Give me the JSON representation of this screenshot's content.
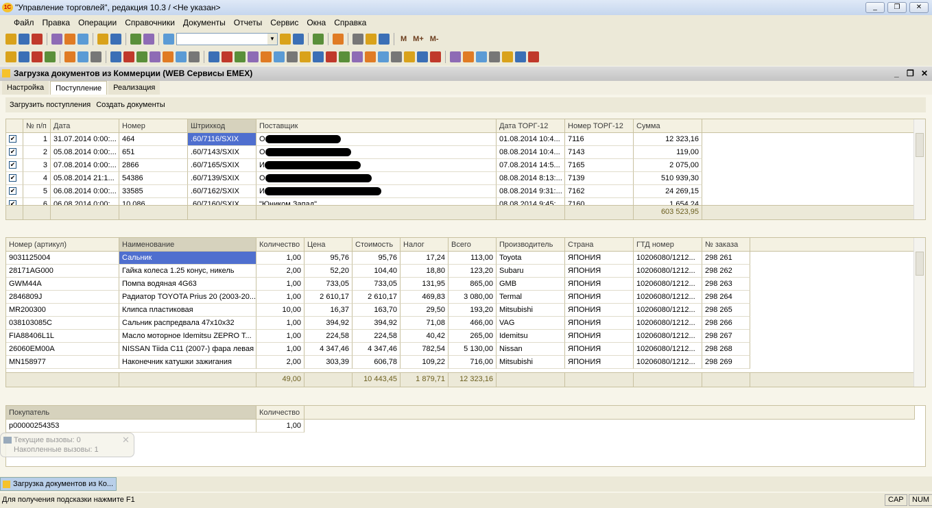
{
  "window": {
    "title": "\"Управление торговлей\", редакция 10.3 / <Не указан>",
    "logo": "1С",
    "buttons": [
      "minimize",
      "restore",
      "close"
    ]
  },
  "menu": [
    "Файл",
    "Правка",
    "Операции",
    "Справочники",
    "Документы",
    "Отчеты",
    "Сервис",
    "Окна",
    "Справка"
  ],
  "toolbar1": {
    "icons": [
      "new-doc-icon",
      "open-icon",
      "save-icon",
      "|",
      "cut-icon",
      "copy-icon",
      "paste-icon",
      "|",
      "print-icon",
      "preview-icon",
      "|",
      "undo-icon",
      "redo-icon",
      "|",
      "search-icon"
    ],
    "icons2": [
      "find-next-icon",
      "find-prev-icon",
      "|",
      "windows-icon",
      "|",
      "info-icon",
      "|",
      "calculator-icon",
      "calendar-icon",
      "users-icon",
      "|"
    ],
    "memory": [
      "M",
      "M+",
      "M-"
    ],
    "search_value": ""
  },
  "toolbar2": {
    "icons": [
      "cabinet-icon",
      "printer1-icon",
      "printer2-icon",
      "printer3-icon",
      "|",
      "people-icon",
      "cash-icon",
      "chart-icon",
      "|",
      "doc1-icon",
      "doc2-icon",
      "doc3-icon",
      "doc4-icon",
      "doc5-icon",
      "doc6-icon",
      "doc7-icon",
      "|",
      "doc8-icon",
      "doc9-icon",
      "doc10-icon",
      "doc11-icon",
      "doc12-icon",
      "doc13-icon",
      "doc14-icon",
      "doc15-icon",
      "doc16-icon",
      "doc17-icon",
      "doc18-icon",
      "doc19-icon",
      "doc20-icon",
      "doc21-icon",
      "doc22-icon",
      "doc23-icon",
      "doc24-icon",
      "doc25-icon",
      "|",
      "rep1-icon",
      "rep2-icon",
      "rep3-icon",
      "rep4-icon",
      "rep5-icon",
      "rep6-icon",
      "rep7-icon"
    ]
  },
  "form": {
    "title": "Загрузка документов из Коммерции (WEB Сервисы EMEX)",
    "tabs": [
      "Настройка",
      "Поступление",
      "Реализация"
    ],
    "active_tab": 1,
    "commands": [
      "Загрузить поступления",
      "Создать документы"
    ]
  },
  "receipts": {
    "columns": [
      "",
      "№ п/п",
      "Дата",
      "Номер",
      "Штрихкод",
      "Поставщик",
      "Дата ТОРГ-12",
      "Номер ТОРГ-12",
      "Сумма"
    ],
    "rows": [
      [
        true,
        "1",
        "31.07.2014 0:00:...",
        "464",
        ".60/7116/SXIX",
        "О",
        "01.08.2014 10:4...",
        "7116",
        "12 323,16"
      ],
      [
        true,
        "2",
        "05.08.2014 0:00:...",
        "651",
        ".60/7143/SXIX",
        "О",
        "08.08.2014 10:4...",
        "7143",
        "119,00"
      ],
      [
        true,
        "3",
        "07.08.2014 0:00:...",
        "2866",
        ".60/7165/SXIX",
        "И",
        "07.08.2014 14:5...",
        "7165",
        "2 075,00"
      ],
      [
        true,
        "4",
        "05.08.2014 21:1...",
        "54386",
        ".60/7139/SXIX",
        "О",
        "08.08.2014 8:13:...",
        "7139",
        "510 939,30"
      ],
      [
        true,
        "5",
        "06.08.2014 0:00:...",
        "33585",
        ".60/7162/SXIX",
        "И",
        "08.08.2014 9:31:...",
        "7162",
        "24 269,15"
      ],
      [
        true,
        "6",
        "06.08.2014 0:00:...",
        "10 086",
        ".60/7160/SXIX",
        "\"Юником Запад\"",
        "08.08.2014 9:45:...",
        "7160",
        "1 654,24"
      ]
    ],
    "total": "603 523,95"
  },
  "items": {
    "columns": [
      "Номер (артикул)",
      "Наименование",
      "Количество",
      "Цена",
      "Стоимость",
      "Налог",
      "Всего",
      "Производитель",
      "Страна",
      "ГТД номер",
      "№ заказа"
    ],
    "rows": [
      [
        "9031125004",
        "Сальник",
        "1,00",
        "95,76",
        "95,76",
        "17,24",
        "113,00",
        "Toyota",
        "ЯПОНИЯ",
        "10206080/1212...",
        "298 261"
      ],
      [
        "28171AG000",
        "Гайка колеса 1.25 конус, никель",
        "2,00",
        "52,20",
        "104,40",
        "18,80",
        "123,20",
        "Subaru",
        "ЯПОНИЯ",
        "10206080/1212...",
        "298 262"
      ],
      [
        "GWM44A",
        "Помпа водяная 4G63",
        "1,00",
        "733,05",
        "733,05",
        "131,95",
        "865,00",
        "GMB",
        "ЯПОНИЯ",
        "10206080/1212...",
        "298 263"
      ],
      [
        "2846809J",
        "Радиатор TOYOTA Prius 20 (2003-20...",
        "1,00",
        "2 610,17",
        "2 610,17",
        "469,83",
        "3 080,00",
        "Termal",
        "ЯПОНИЯ",
        "10206080/1212...",
        "298 264"
      ],
      [
        "MR200300",
        "Клипса пластиковая",
        "10,00",
        "16,37",
        "163,70",
        "29,50",
        "193,20",
        "Mitsubishi",
        "ЯПОНИЯ",
        "10206080/1212...",
        "298 265"
      ],
      [
        "038103085C",
        "Сальник распредвала 47x10x32",
        "1,00",
        "394,92",
        "394,92",
        "71,08",
        "466,00",
        "VAG",
        "ЯПОНИЯ",
        "10206080/1212...",
        "298 266"
      ],
      [
        "FIA88406L1L",
        "Масло моторное Idemitsu ZEPRO T...",
        "1,00",
        "224,58",
        "224,58",
        "40,42",
        "265,00",
        "Idemitsu",
        "ЯПОНИЯ",
        "10206080/1212...",
        "298 267"
      ],
      [
        "26060EM00A",
        "NISSAN Tiida C11 (2007-) фара левая",
        "1,00",
        "4 347,46",
        "4 347,46",
        "782,54",
        "5 130,00",
        "Nissan",
        "ЯПОНИЯ",
        "10206080/1212...",
        "298 268"
      ],
      [
        "MN158977",
        "Наконечник катушки зажигания",
        "2,00",
        "303,39",
        "606,78",
        "109,22",
        "716,00",
        "Mitsubishi",
        "ЯПОНИЯ",
        "10206080/1212...",
        "298 269"
      ]
    ],
    "totals": [
      "",
      "",
      "49,00",
      "",
      "10 443,45",
      "1 879,71",
      "12 323,16",
      "",
      "",
      "",
      ""
    ]
  },
  "buyers": {
    "columns": [
      "Покупатель",
      "Количество"
    ],
    "rows": [
      [
        "p00000254353",
        "1,00"
      ]
    ]
  },
  "popup": {
    "line1": "Текущие вызовы: 0",
    "line2": "Накопленные вызовы: 1"
  },
  "taskbar": {
    "item": "Загрузка документов из Ко..."
  },
  "status": {
    "hint": "Для получения подсказки нажмите F1",
    "cap": "CAP",
    "num": "NUM"
  },
  "colors": {
    "selection": "#4f6fcf",
    "grid_line": "#c8c1a0",
    "panel": "#ece9d8"
  }
}
